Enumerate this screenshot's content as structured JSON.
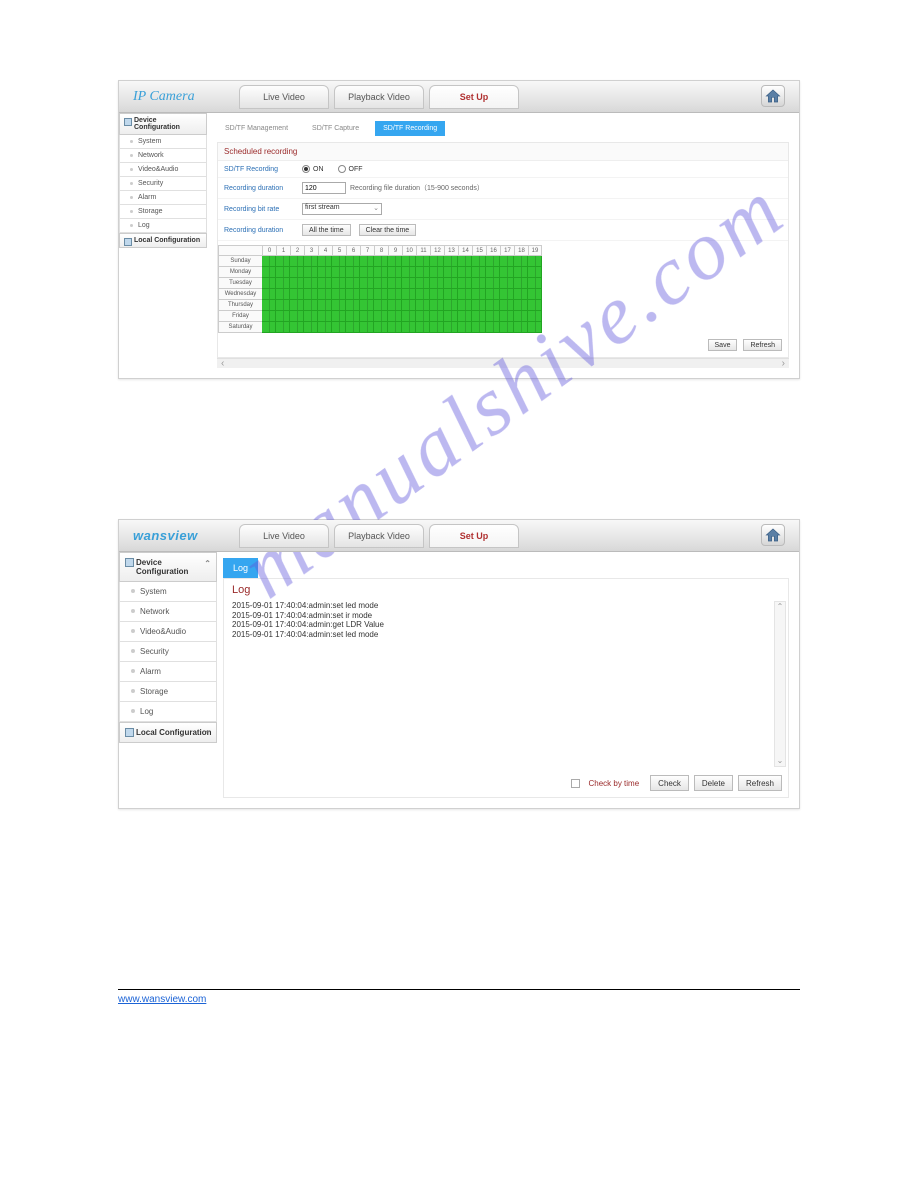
{
  "watermark": "manualshive.com",
  "shot1": {
    "logo": "IP Camera",
    "nav": {
      "live": "Live Video",
      "playback": "Playback Video",
      "setup": "Set Up"
    },
    "sidebar": {
      "hdr1": "Device Configuration",
      "items": [
        "System",
        "Network",
        "Video&Audio",
        "Security",
        "Alarm",
        "Storage",
        "Log"
      ],
      "hdr2": "Local Configuration"
    },
    "subtabs": {
      "a": "SD/TF Management",
      "b": "SD/TF Capture",
      "c": "SD/TF Recording"
    },
    "panel": {
      "title": "Scheduled recording",
      "recording_lbl": "SD/TF Recording",
      "on": "ON",
      "off": "OFF",
      "duration_lbl": "Recording duration",
      "duration_val": "120",
      "duration_note": "Recording file duration（15-900 seconds）",
      "bitrate_lbl": "Recording bit rate",
      "bitrate_val": "first stream",
      "dur2_lbl": "Recording duration",
      "all_btn": "All the time",
      "clr_btn": "Clear the time",
      "hours": [
        "0",
        "1",
        "2",
        "3",
        "4",
        "5",
        "6",
        "7",
        "8",
        "9",
        "10",
        "11",
        "12",
        "13",
        "14",
        "15",
        "16",
        "17",
        "18",
        "19"
      ],
      "days": [
        "Sunday",
        "Monday",
        "Tuesday",
        "Wednesday",
        "Thursday",
        "Friday",
        "Saturday"
      ],
      "save": "Save",
      "refresh": "Refresh"
    }
  },
  "shot2": {
    "logo": "wansview",
    "nav": {
      "live": "Live Video",
      "playback": "Playback Video",
      "setup": "Set Up"
    },
    "sidebar": {
      "hdr1": "Device Configuration",
      "items": [
        "System",
        "Network",
        "Video&Audio",
        "Security",
        "Alarm",
        "Storage",
        "Log"
      ],
      "hdr2": "Local Configuration"
    },
    "logtab": "Log",
    "loghdr": "Log",
    "entries": [
      "2015-09-01 17:40:04:admin:set led mode",
      "2015-09-01 17:40:04:admin:set ir mode",
      "2015-09-01 17:40:04:admin:get LDR Value",
      "2015-09-01 17:40:04:admin:set led mode"
    ],
    "check_lbl": "Check by time",
    "btns": {
      "check": "Check",
      "delete": "Delete",
      "refresh": "Refresh"
    }
  },
  "footer_web": "www.wansview.com"
}
